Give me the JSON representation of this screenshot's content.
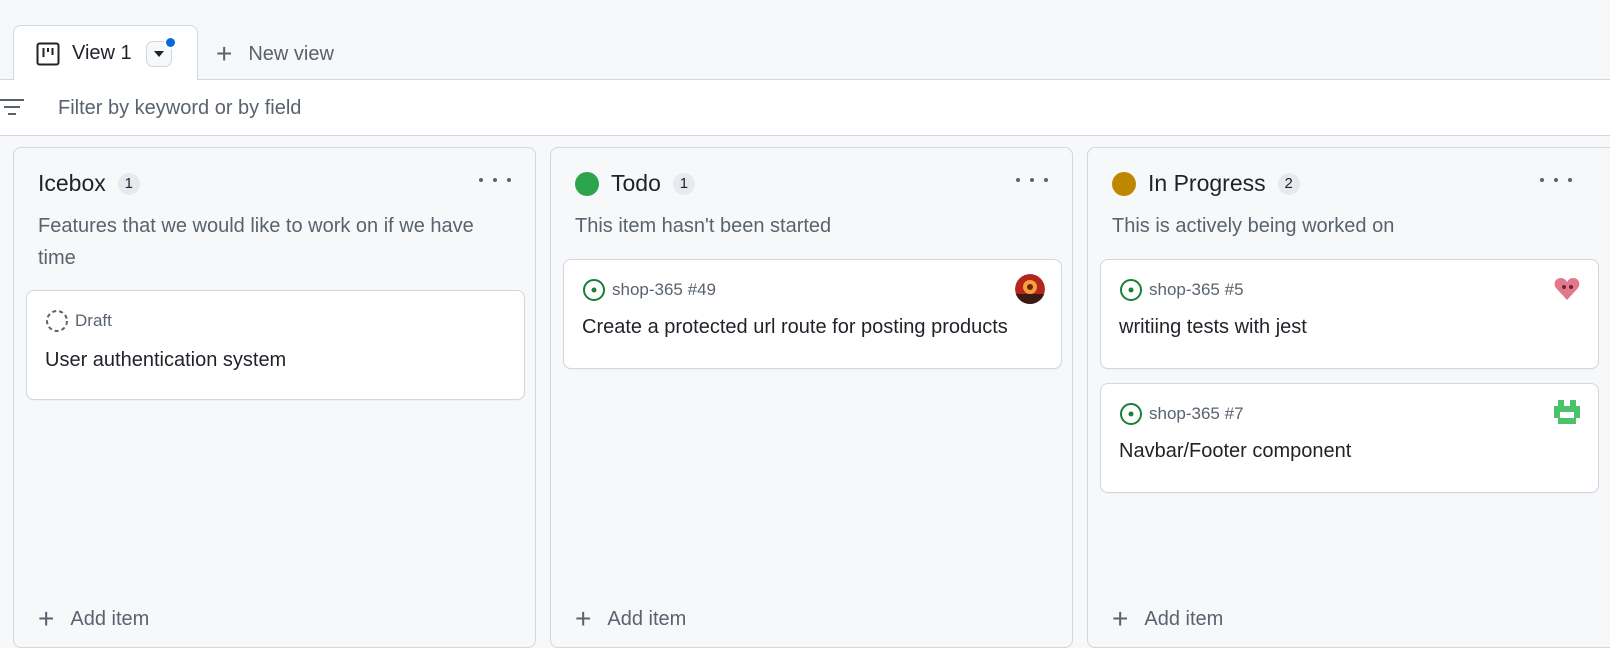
{
  "tabs": {
    "active_label": "View 1",
    "new_view_label": "New view"
  },
  "filter": {
    "placeholder": "Filter by keyword or by field"
  },
  "columns": [
    {
      "title": "Icebox",
      "count": "1",
      "description": "Features that we would like to work on if we have time",
      "status_color": null,
      "add_label": "Add item",
      "cards": [
        {
          "meta": "Draft",
          "title": "User authentication system",
          "icon": "draft-circle-icon"
        }
      ]
    },
    {
      "title": "Todo",
      "count": "1",
      "description": "This item hasn't been started",
      "status_color": "#2da44e",
      "add_label": "Add item",
      "cards": [
        {
          "meta": "shop-365 #49",
          "title": "Create a protected url route for posting products",
          "icon": "issue-open-icon"
        }
      ]
    },
    {
      "title": "In Progress",
      "count": "2",
      "description": "This is actively being worked on",
      "status_color": "#bf8700",
      "add_label": "Add item",
      "cards": [
        {
          "meta": "shop-365 #5",
          "title": "writiing tests with jest",
          "icon": "issue-open-icon"
        },
        {
          "meta": "shop-365 #7",
          "title": "Navbar/Footer component",
          "icon": "issue-open-icon"
        }
      ]
    }
  ],
  "colors": {
    "accent": "#0969da",
    "issue_open": "#1a7f37",
    "todo": "#2da44e",
    "in_progress": "#bf8700"
  }
}
